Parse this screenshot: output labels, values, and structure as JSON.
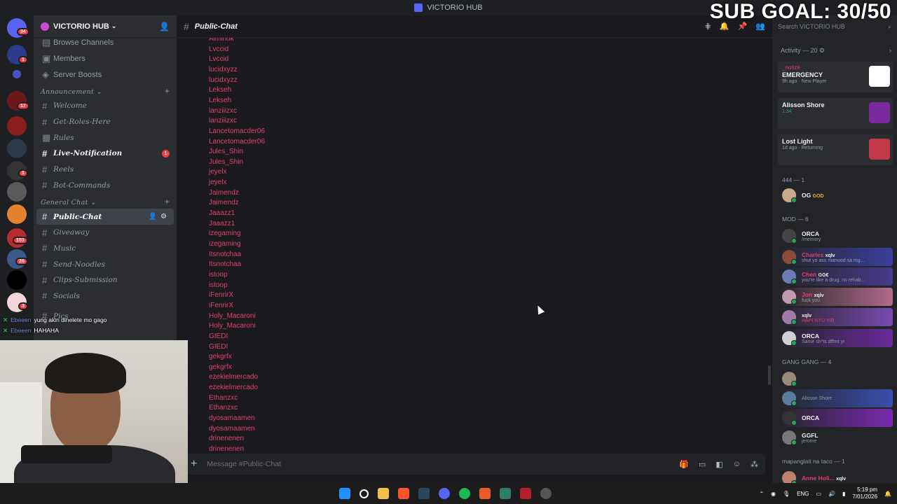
{
  "window": {
    "title": "VICTORIO HUB"
  },
  "overlay": {
    "sub_goal": "SUB GOAL: 30/50"
  },
  "rail": {
    "badges": [
      "34",
      "1",
      "17",
      "1",
      "103",
      "26",
      "3"
    ]
  },
  "server": {
    "name": "VICTORIO HUB"
  },
  "sidebar": {
    "top_items": [
      "Browse Channels",
      "Members",
      "Server Boosts"
    ],
    "categories": [
      {
        "name": "Announcement",
        "channels": [
          {
            "label": "Welcome"
          },
          {
            "label": "Get-Roles-Here"
          },
          {
            "label": "Rules"
          },
          {
            "label": "Live-Notification",
            "badge": "1"
          },
          {
            "label": "Reels"
          },
          {
            "label": "Bot-Commands"
          }
        ]
      },
      {
        "name": "General Chat",
        "channels": [
          {
            "label": "Public-Chat"
          },
          {
            "label": "Giveaway"
          },
          {
            "label": "Music"
          },
          {
            "label": "Send-Noodles"
          },
          {
            "label": "Clips-Submission"
          },
          {
            "label": "Socials"
          },
          {
            "label": "Pics"
          }
        ]
      }
    ]
  },
  "chat": {
    "channel": "Public-Chat",
    "placeholder": "Message #Public-Chat",
    "messages": [
      "Aiminok",
      "Lvccid",
      "Lvccid",
      "lucidxyzz",
      "lucidxyzz",
      "Lekseh",
      "Lekseh",
      "lanziiizxc",
      "lanziiizxc",
      "Lancetomacder06",
      "Lancetomacder06",
      "Jules_Shin",
      "Jules_Shin",
      "jeyelx",
      "jeyelx",
      "Jaimendz",
      "Jaimendz",
      "Jaaazz1",
      "Jaaazz1",
      "izegaming",
      "izegaming",
      "Itsnotchaa",
      "Itsnotchaa",
      "istoop",
      "istoop",
      "iFenrirX",
      "iFenrirX",
      "Holy_Macaroni",
      "Holy_Macaroni",
      "GIEDI",
      "GIEDI",
      "gekgrfx",
      "gekgrfx",
      "ezekielmercado",
      "ezekielmercado",
      "Ethanzxc",
      "Ethanzxc",
      "dyosamaamen",
      "dyosamaamen",
      "drinenenen",
      "drinenenen"
    ]
  },
  "members": {
    "search_placeholder": "Search VICTORIO HUB",
    "activity_header": "Activity — 20",
    "activity": [
      {
        "user": "_notize",
        "title": "EMERGENCY",
        "sub": "9h ago · New Player",
        "art_color": "#ffffff"
      },
      {
        "user": "",
        "title": "Alisson Shore",
        "sub": "1:34",
        "art_color": "#7a2a9c"
      },
      {
        "user": "",
        "title": "Lost Light",
        "sub": "1d ago · Returning",
        "art_color": "#c23a4a"
      }
    ],
    "groups": [
      {
        "name": "444 — 1",
        "members": [
          {
            "name": "OG",
            "tag": "GOD",
            "status": ""
          }
        ]
      },
      {
        "name": "MOD — 6",
        "members": [
          {
            "name": "ORCA",
            "status": "/memory"
          },
          {
            "name": "Charles",
            "tag": "xqlv",
            "status": "shut yo ass manood sa mg..."
          },
          {
            "name": "Chen",
            "tag": "GG€",
            "status": "you're like a drug, no rehab..."
          },
          {
            "name": "Jon",
            "tag": "xqlv",
            "status": "fuck you"
          },
          {
            "name": "",
            "tag": "xqlv",
            "status": "HAPI NYU YIR"
          },
          {
            "name": "ORCA",
            "status": "Same sh*ts dffrnt yr"
          }
        ]
      },
      {
        "name": "GANG GANG — 4",
        "members": [
          {
            "name": "",
            "status": ""
          },
          {
            "name": "",
            "status": "Alisson Shore"
          },
          {
            "name": "ORCA",
            "status": ""
          },
          {
            "name": "GGFL",
            "status": "jerome"
          }
        ]
      },
      {
        "name": "mapanglait na taco — 1",
        "members": [
          {
            "name": "Anne Holi...",
            "tag": "xqlv",
            "status": ""
          }
        ]
      }
    ]
  },
  "stream_chat": [
    {
      "name": "Ebeeen",
      "text": "yung akin dinelete mo gago"
    },
    {
      "name": "Ebeeen",
      "text": "HAHAHA"
    }
  ],
  "taskbar": {
    "lang": "ENG",
    "time": "5:19 pm",
    "date": "7/01/2026"
  }
}
